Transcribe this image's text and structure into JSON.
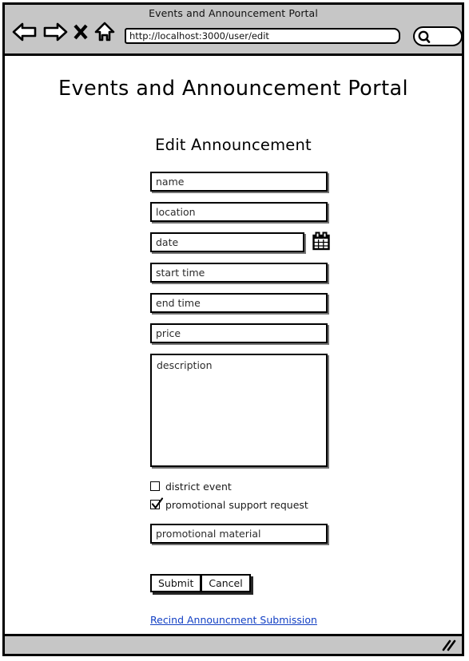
{
  "browser": {
    "window_title": "Events and Announcement Portal",
    "url": "http://localhost:3000/user/edit",
    "search_placeholder": "",
    "icons": {
      "back": "back-arrow-icon",
      "forward": "forward-arrow-icon",
      "stop": "close-x-icon",
      "home": "home-icon",
      "search": "search-icon",
      "resize": "resize-grip-icon"
    }
  },
  "page": {
    "title": "Events and Announcement Portal",
    "section_title": "Edit Announcement"
  },
  "form": {
    "fields": [
      {
        "name": "name-field",
        "placeholder": "name",
        "value": ""
      },
      {
        "name": "location-field",
        "placeholder": "location",
        "value": ""
      },
      {
        "name": "date-field",
        "placeholder": "date",
        "value": ""
      },
      {
        "name": "start-time-field",
        "placeholder": "start time",
        "value": ""
      },
      {
        "name": "end-time-field",
        "placeholder": "end time",
        "value": ""
      },
      {
        "name": "price-field",
        "placeholder": "price",
        "value": ""
      },
      {
        "name": "promotional-material-field",
        "placeholder": "promotional material",
        "value": ""
      }
    ],
    "description": {
      "placeholder": "description",
      "value": ""
    },
    "calendar_icon": "calendar-icon",
    "checkboxes": [
      {
        "label": "district event",
        "checked": false
      },
      {
        "label": "promotional support request",
        "checked": true
      }
    ],
    "buttons": {
      "submit": "Submit",
      "cancel": "Cancel"
    },
    "rescind_link": "Recind Announcment Submission"
  },
  "colors": {
    "chrome": "#c6c6c6",
    "border": "#000000",
    "link": "#1340c4",
    "page_bg": "#ffffff"
  }
}
